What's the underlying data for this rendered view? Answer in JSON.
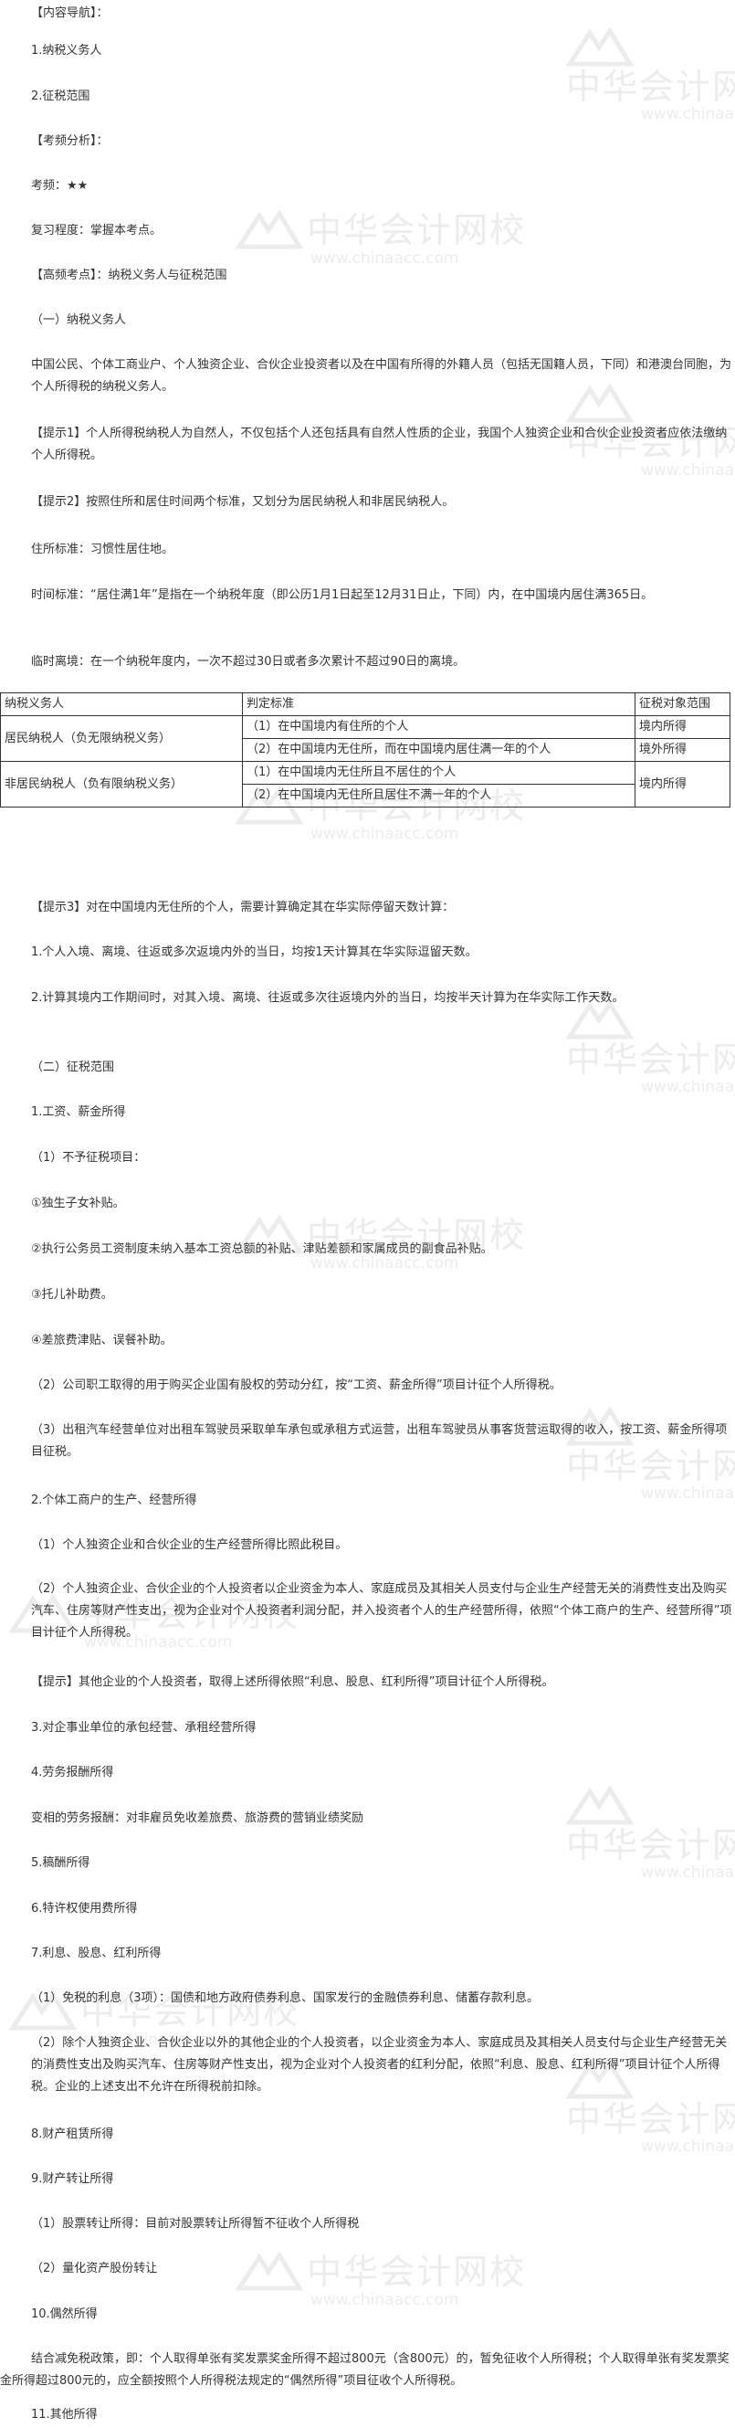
{
  "watermark": {
    "cn": "中华会计网校",
    "url": "www.chinaacc.com"
  },
  "paragraphs": [
    "【内容导航】：",
    "1.纳税义务人",
    "2.征税范围",
    "【考频分析】：",
    "考频：★★",
    "复习程度：掌握本考点。",
    "【高频考点】：纳税义务人与征税范围",
    "（一）纳税义务人",
    "中国公民、个体工商业户、个人独资企业、合伙企业投资者以及在中国有所得的外籍人员（包括无国籍人员，下同）和港澳台同胞，为个人所得税的纳税义务人。",
    "【提示1】个人所得税纳税人为自然人，不仅包括个人还包括具有自然人性质的企业，我国个人独资企业和合伙企业投资者应依法缴纳个人所得税。",
    "【提示2】按照住所和居住时间两个标准，又划分为居民纳税人和非居民纳税人。",
    "住所标准：习惯性居住地。",
    "时间标准：“居住满1年”是指在一个纳税年度（即公历1月1日起至12月31日止，下同）内，在中国境内居住满365日。",
    "临时离境：在一个纳税年度内，一次不超过30日或者多次累计不超过90日的离境。",
    "【提示3】对在中国境内无住所的个人，需要计算确定其在华实际停留天数计算：",
    "1.个人入境、离境、往返或多次返境内外的当日，均按1天计算其在华实际逗留天数。",
    "2.计算其境内工作期间时，对其入境、离境、往返或多次往返境内外的当日，均按半天计算为在华实际工作天数。",
    "（二）征税范围",
    "1.工资、薪金所得",
    "（1）不予征税项目：",
    "①独生子女补贴。",
    "②执行公务员工资制度未纳入基本工资总额的补贴、津贴差额和家属成员的副食品补贴。",
    "③托儿补助费。",
    "④差旅费津贴、误餐补助。",
    "（2）公司职工取得的用于购买企业国有股权的劳动分红，按“工资、薪金所得”项目计征个人所得税。",
    "（3）出租汽车经营单位对出租车驾驶员采取单车承包或承租方式运营，出租车驾驶员从事客货营运取得的收入，按工资、薪金所得项目征税。",
    "2.个体工商户的生产、经营所得",
    "（1）个人独资企业和合伙企业的生产经营所得比照此税目。",
    "（2）个人独资企业、合伙企业的个人投资者以企业资金为本人、家庭成员及其相关人员支付与企业生产经营无关的消费性支出及购买汽车、住房等财产性支出，视为企业对个人投资者利润分配，并入投资者个人的生产经营所得，依照“个体工商户的生产、经营所得”项目计征个人所得税。",
    "【提示】其他企业的个人投资者，取得上述所得依照“利息、股息、红利所得”项目计征个人所得税。",
    "3.对企事业单位的承包经营、承租经营所得",
    "4.劳务报酬所得",
    "变相的劳务报酬：对非雇员免收差旅费、旅游费的营销业绩奖励",
    "5.稿酬所得",
    "6.特许权使用费所得",
    "7.利息、股息、红利所得",
    "（1）免税的利息（3项）：国债和地方政府债券利息、国家发行的金融债券利息、储蓄存款利息。",
    "（2）除个人独资企业、合伙企业以外的其他企业的个人投资者，以企业资金为本人、家庭成员及其相关人员支付与企业生产经营无关的消费性支出及购买汽车、住房等财产性支出，视为企业对个人投资者的红利分配，依照“利息、股息、红利所得”项目计征个人所得税。企业的上述支出不允许在所得税前扣除。",
    "8.财产租赁所得",
    "9.财产转让所得",
    "（1）股票转让所得：目前对股票转让所得暂不征收个人所得税",
    "（2）量化资产股份转让",
    "10.偶然所得",
    "结合减免税政策，即：个人取得单张有奖发票奖金所得不超过800元（含800元）的，暂免征收个人所得税；个人取得单张有奖发票奖金所得超过800元的，应全额按照个人所得税法规定的“偶然所得”项目征收个人所得税。",
    "11.其他所得"
  ],
  "table": {
    "headers": [
      "纳税义务人",
      "判定标准",
      "征税对象范围"
    ],
    "rows": [
      {
        "taxpayer": "居民纳税人（负无限纳税义务）",
        "criteria": [
          "（1）在中国境内有住所的个人",
          "（2）在中国境内无住所，而在中国境内居住满一年的个人"
        ],
        "scope": [
          "境内所得",
          "境外所得"
        ]
      },
      {
        "taxpayer": "非居民纳税人（负有限纳税义务）",
        "criteria": [
          "（1）在中国境内无住所且不居住的个人",
          "（2）在中国境内无住所且居住不满一年的个人"
        ],
        "scope": [
          "境内所得"
        ]
      }
    ]
  }
}
